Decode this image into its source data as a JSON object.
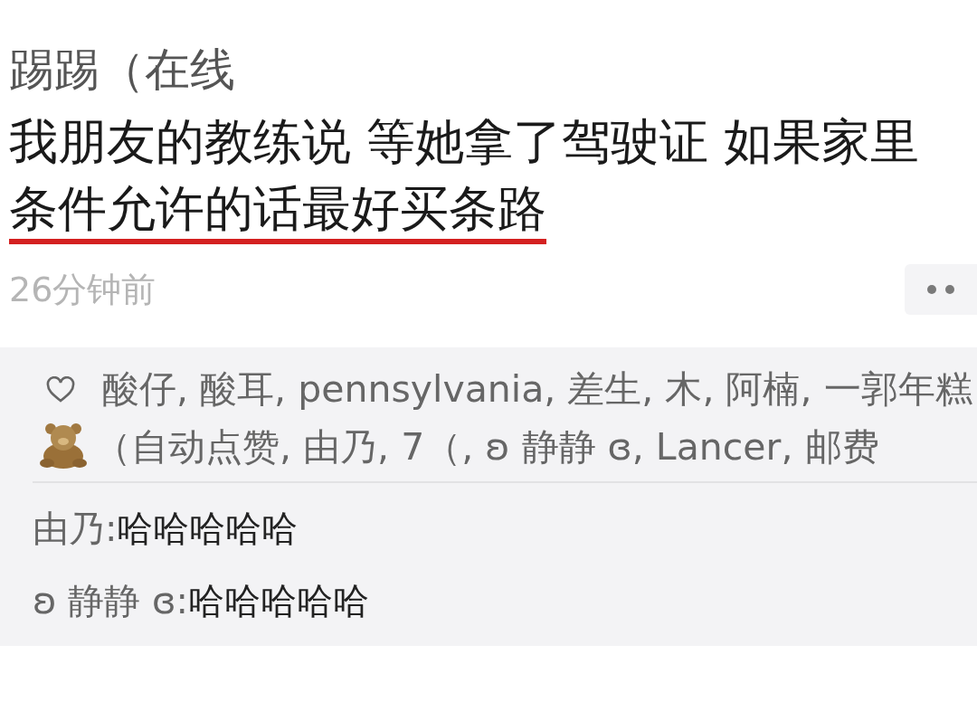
{
  "post": {
    "author": "踢踢（在线",
    "text_parts": [
      {
        "text": "我朋友的教练说 等她拿了驾驶证 如果家里",
        "underlined": false
      },
      {
        "text": "条件允许的话最好买条路",
        "underlined": true
      }
    ],
    "time": "26分钟前"
  },
  "likes": {
    "parts": [
      {
        "kind": "text",
        "text": "酸仔, 酸耳, pennsylvania, 差生, 木, 阿楠, 一郭年糕"
      },
      {
        "kind": "emoji"
      },
      {
        "kind": "text",
        "text": "（自动点赞, 由乃, 7（, ʚ 静静 ɞ, Lancer, 邮费"
      }
    ]
  },
  "comments": [
    {
      "author": "由乃:",
      "text": "哈哈哈哈哈"
    },
    {
      "author": "ʚ 静静 ɞ:",
      "text": "哈哈哈哈哈"
    }
  ]
}
